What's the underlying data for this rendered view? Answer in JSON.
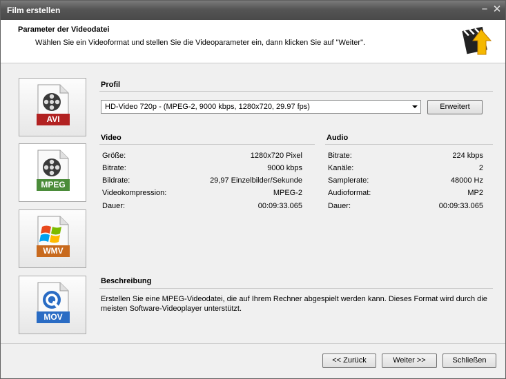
{
  "window": {
    "title": "Film erstellen"
  },
  "header": {
    "title": "Parameter der Videodatei",
    "subtitle": "Wählen Sie ein Videoformat und stellen Sie die Videoparameter ein, dann klicken Sie auf \"Weiter\"."
  },
  "formats": [
    {
      "label": "AVI",
      "color": "#b22222",
      "selected": false
    },
    {
      "label": "MPEG",
      "color": "#4b8c3a",
      "selected": true
    },
    {
      "label": "WMV",
      "color": "#c86a1e",
      "selected": false
    },
    {
      "label": "MOV",
      "color": "#2a6cc4",
      "selected": false
    }
  ],
  "profile": {
    "title": "Profil",
    "selected": "HD-Video 720p - (MPEG-2, 9000 kbps, 1280x720, 29.97 fps)",
    "advanced_label": "Erweitert"
  },
  "video": {
    "title": "Video",
    "rows": [
      {
        "key": "Größe:",
        "value": "1280x720 Pixel"
      },
      {
        "key": "Bitrate:",
        "value": "9000 kbps"
      },
      {
        "key": "Bildrate:",
        "value": "29,97 Einzelbilder/Sekunde"
      },
      {
        "key": "Videokompression:",
        "value": "MPEG-2"
      },
      {
        "key": "Dauer:",
        "value": "00:09:33.065"
      }
    ]
  },
  "audio": {
    "title": "Audio",
    "rows": [
      {
        "key": "Bitrate:",
        "value": "224 kbps"
      },
      {
        "key": "Kanäle:",
        "value": "2"
      },
      {
        "key": "Samplerate:",
        "value": "48000 Hz"
      },
      {
        "key": "Audioformat:",
        "value": "MP2"
      },
      {
        "key": "Dauer:",
        "value": "00:09:33.065"
      }
    ]
  },
  "description": {
    "title": "Beschreibung",
    "text": "Erstellen Sie eine MPEG-Videodatei, die auf Ihrem Rechner abgespielt werden kann. Dieses Format wird durch die meisten Software-Videoplayer unterstützt."
  },
  "footer": {
    "back_label": "<< Zurück",
    "next_label": "Weiter >>",
    "close_label": "Schließen"
  }
}
